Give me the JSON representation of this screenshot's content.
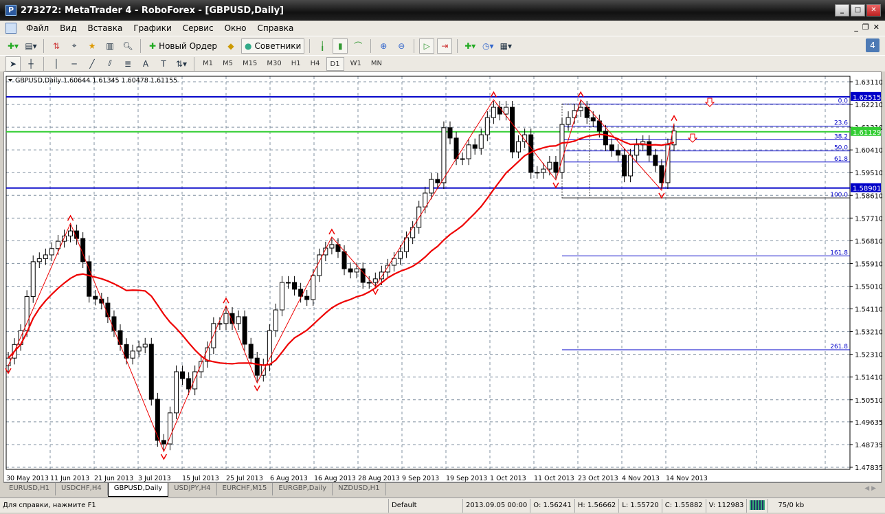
{
  "window": {
    "title": "273272: MetaTrader 4 - RoboForex - [GBPUSD,Daily]"
  },
  "menu": [
    "Файл",
    "Вид",
    "Вставка",
    "Графики",
    "Сервис",
    "Окно",
    "Справка"
  ],
  "toolbar": {
    "new_order": "Новый Ордер",
    "experts": "Советники",
    "timeframes": [
      "M1",
      "M5",
      "M15",
      "M30",
      "H1",
      "H4",
      "D1",
      "W1",
      "MN"
    ],
    "active_timeframe": "D1"
  },
  "chart": {
    "header": "GBPUSD,Daily  1.60644 1.61345 1.60478 1.61155",
    "price_labels": [
      "1.63110",
      "1.62210",
      "1.61310",
      "1.60410",
      "1.59510",
      "1.58610",
      "1.57710",
      "1.56810",
      "1.55910",
      "1.55010",
      "1.54110",
      "1.53210",
      "1.52310",
      "1.51410",
      "1.50510",
      "1.49635",
      "1.48735",
      "1.47835"
    ],
    "date_labels": [
      "30 May 2013",
      "11 Jun 2013",
      "21 Jun 2013",
      "3 Jul 2013",
      "15 Jul 2013",
      "25 Jul 2013",
      "6 Aug 2013",
      "16 Aug 2013",
      "28 Aug 2013",
      "9 Sep 2013",
      "19 Sep 2013",
      "1 Oct 2013",
      "11 Oct 2013",
      "23 Oct 2013",
      "4 Nov 2013",
      "14 Nov 2013"
    ],
    "hlines": [
      {
        "price": 1.62515,
        "label": "1.62515",
        "color": "#0000c8"
      },
      {
        "price": 1.61129,
        "label": "1.61129",
        "color": "#32cd32"
      },
      {
        "price": 1.58901,
        "label": "1.58901",
        "color": "#0000c8"
      }
    ],
    "fib": {
      "p0": 1.6223,
      "p100": 1.5851,
      "levels": [
        {
          "r": 0,
          "label": "0.0"
        },
        {
          "r": 0.236,
          "label": "23.6"
        },
        {
          "r": 0.382,
          "label": "38.2"
        },
        {
          "r": 0.5,
          "label": "50.0"
        },
        {
          "r": 0.618,
          "label": "61.8"
        },
        {
          "r": 1,
          "label": "100.0"
        },
        {
          "r": 1.618,
          "label": "161.8"
        },
        {
          "r": 2.618,
          "label": "261.8"
        }
      ]
    },
    "ylim": [
      1.47835,
      1.6311
    ]
  },
  "chart_data": {
    "type": "candlestick",
    "symbol": "GBPUSD",
    "period": "Daily",
    "closes": [
      1.5216,
      1.527,
      1.5325,
      1.546,
      1.5598,
      1.561,
      1.5625,
      1.565,
      1.5679,
      1.57,
      1.572,
      1.569,
      1.5598,
      1.5461,
      1.545,
      1.5434,
      1.538,
      1.5325,
      1.527,
      1.5216,
      1.5244,
      1.526,
      1.5271,
      1.5053,
      1.489,
      1.4876,
      1.4999,
      1.5162,
      1.5135,
      1.5094,
      1.5162,
      1.5203,
      1.5257,
      1.5353,
      1.5353,
      1.5393,
      1.5353,
      1.538,
      1.5271,
      1.5216,
      1.5148,
      1.5189,
      1.5325,
      1.5407,
      1.5516,
      1.5516,
      1.5489,
      1.5461,
      1.5448,
      1.5543,
      1.5625,
      1.5652,
      1.5666,
      1.5638,
      1.557,
      1.5557,
      1.557,
      1.5516,
      1.5516,
      1.553,
      1.5557,
      1.5584,
      1.5611,
      1.5638,
      1.5693,
      1.5734,
      1.5815,
      1.587,
      1.5924,
      1.5911,
      1.6129,
      1.6088,
      1.6006,
      1.6006,
      1.6061,
      1.6047,
      1.6101,
      1.6169,
      1.621,
      1.6183,
      1.621,
      1.6033,
      1.6074,
      1.6101,
      1.5952,
      1.5952,
      1.5965,
      1.5992,
      1.5952,
      1.6142,
      1.6169,
      1.6197,
      1.621,
      1.6169,
      1.6156,
      1.6115,
      1.6061,
      1.6039,
      1.602,
      1.5938,
      1.602,
      1.6061,
      1.6074,
      1.602,
      1.5979,
      1.5911,
      1.6061,
      1.6116
    ],
    "zigzag_pivots": [
      0,
      10,
      25,
      35,
      40,
      52,
      59,
      78,
      88,
      92,
      105,
      107
    ],
    "ma_period": 20
  },
  "tabs": [
    "EURUSD,H1",
    "USDCHF,H4",
    "GBPUSD,Daily",
    "USDJPY,H4",
    "EURCHF,M15",
    "EURGBP,Daily",
    "NZDUSD,H1"
  ],
  "active_tab": "GBPUSD,Daily",
  "status": {
    "help": "Для справки, нажмите F1",
    "profile": "Default",
    "time": "2013.09.05 00:00",
    "open": "O: 1.56241",
    "high": "H: 1.56662",
    "low": "L: 1.55720",
    "close": "C: 1.55882",
    "volume": "V: 112983",
    "traffic": "75/0 kb"
  }
}
